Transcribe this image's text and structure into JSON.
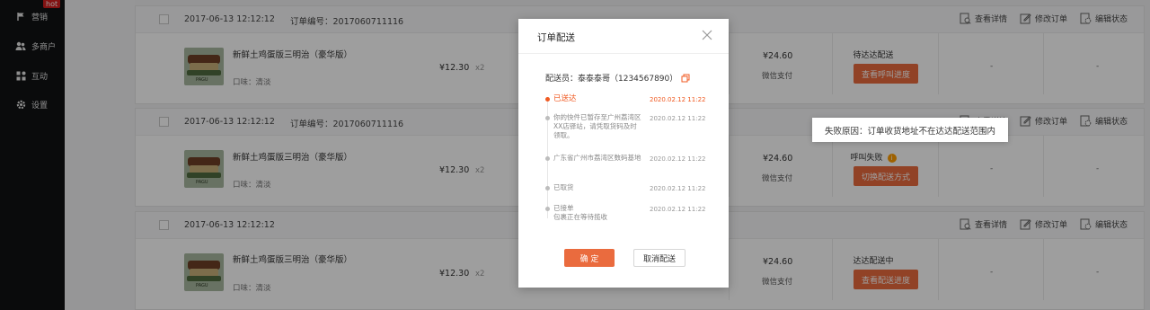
{
  "sidebar": {
    "items": [
      {
        "label": "营销",
        "icon": "flag-icon"
      },
      {
        "label": "多商户",
        "icon": "users-icon"
      },
      {
        "label": "互动",
        "icon": "grid-icon"
      },
      {
        "label": "设置",
        "icon": "gear-icon"
      }
    ],
    "hot_badge": "hot"
  },
  "orders": [
    {
      "date": "2017-06-13 12:12:12",
      "order_no": "订单编号：2017060711116",
      "actions": [
        "查看详情",
        "修改订单",
        "编辑状态"
      ],
      "product_title": "新鲜土鸡蛋版三明治（豪华版）",
      "product_spec": "口味：清淡",
      "price": "¥12.30",
      "qty": "x2",
      "pay_amount": "¥24.60",
      "pay_method": "微信支付",
      "status": "待达达配送",
      "status_button": "查看呼叫进度",
      "dash1": "-",
      "dash2": "-"
    },
    {
      "date": "2017-06-13 12:12:12",
      "order_no": "订单编号：2017060711116",
      "actions": [
        "查看详情",
        "修改订单",
        "编辑状态"
      ],
      "product_title": "新鲜土鸡蛋版三明治（豪华版）",
      "product_spec": "口味：清淡",
      "price": "¥12.30",
      "qty": "x2",
      "pay_amount": "¥24.60",
      "pay_method": "微信支付",
      "status": "呼叫失败",
      "status_button": "切换配送方式",
      "dash1": "-",
      "dash2": "-"
    },
    {
      "date": "2017-06-13 12:12:12",
      "order_no": "",
      "actions": [
        "查看详情",
        "修改订单",
        "编辑状态"
      ],
      "product_title": "新鲜土鸡蛋版三明治（豪华版）",
      "product_spec": "口味：清淡",
      "price": "¥12.30",
      "qty": "x2",
      "pay_amount": "¥24.60",
      "pay_method": "微信支付",
      "status": "达达配送中",
      "status_button": "查看配送进度",
      "dash1": "-",
      "dash2": "-"
    }
  ],
  "tooltip": "失败原因：订单收货地址不在达达配送范围内",
  "modal": {
    "title": "订单配送",
    "courier": "配送员：泰泰泰哥（1234567890）",
    "timeline": [
      {
        "text": "已送达",
        "time": "2020.02.12  11:22",
        "active": true
      },
      {
        "text": "你的快件已暂存至广州荔湾区XX店驿站，请凭取货码及时领取。",
        "time": "2020.02.12  11:22",
        "active": false
      },
      {
        "text": "广东省广州市荔湾区数码基地",
        "time": "2020.02.12  11:22",
        "active": false
      },
      {
        "text": "已取货",
        "time": "2020.02.12  11:22",
        "active": false
      },
      {
        "text": "已接单",
        "sub": "包裹正在等待揽收",
        "time": "2020.02.12  11:22",
        "active": false
      }
    ],
    "confirm": "确 定",
    "cancel": "取消配送"
  },
  "colors": {
    "accent": "#ea6b3e",
    "active_text": "#f05a22",
    "sidebar_bg": "#111214",
    "hot_badge": "#d21e1e"
  }
}
